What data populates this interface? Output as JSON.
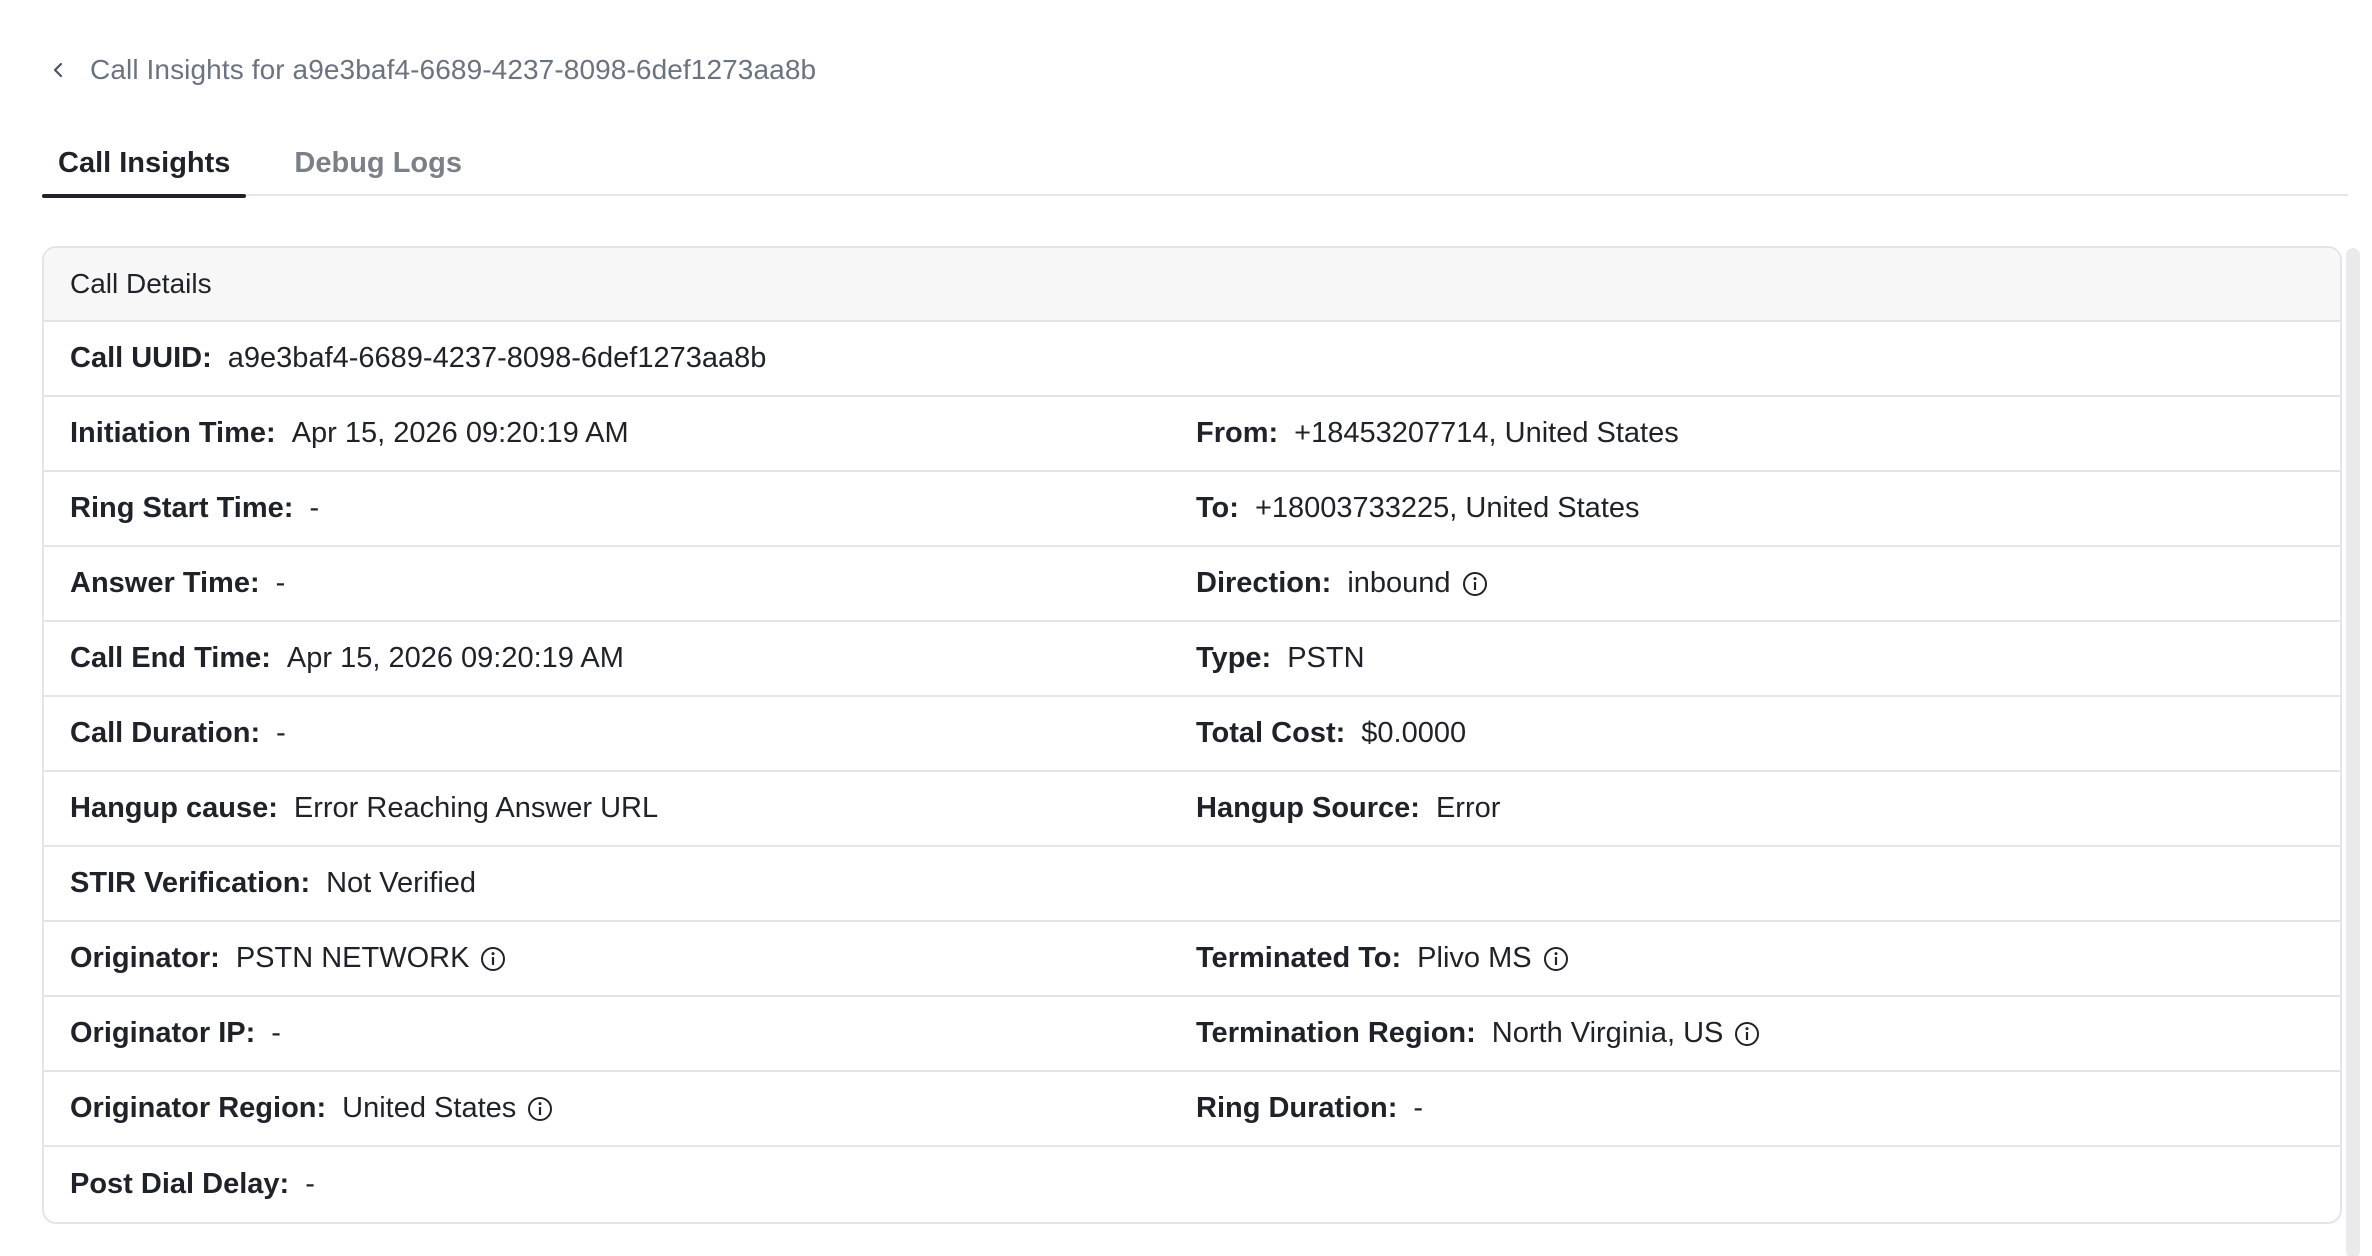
{
  "header": {
    "back_icon": "chevron-left-icon",
    "title": "Call Insights for a9e3baf4-6689-4237-8098-6def1273aa8b"
  },
  "tabs": [
    {
      "label": "Call Insights",
      "active": true
    },
    {
      "label": "Debug Logs",
      "active": false
    }
  ],
  "card": {
    "title": "Call Details",
    "call_uuid": {
      "label": "Call UUID:",
      "value": "a9e3baf4-6689-4237-8098-6def1273aa8b"
    },
    "initiation_time": {
      "label": "Initiation Time:",
      "value": "Apr 15, 2026 09:20:19 AM"
    },
    "from": {
      "label": "From:",
      "value": "+18453207714, United States"
    },
    "ring_start_time": {
      "label": "Ring Start Time:",
      "value": "-"
    },
    "to": {
      "label": "To:",
      "value": "+18003733225, United States"
    },
    "answer_time": {
      "label": "Answer Time:",
      "value": "-"
    },
    "direction": {
      "label": "Direction:",
      "value": "inbound"
    },
    "call_end_time": {
      "label": "Call End Time:",
      "value": "Apr 15, 2026 09:20:19 AM"
    },
    "type": {
      "label": "Type:",
      "value": "PSTN"
    },
    "call_duration": {
      "label": "Call Duration:",
      "value": "-"
    },
    "total_cost": {
      "label": "Total Cost:",
      "value": "$0.0000"
    },
    "hangup_cause": {
      "label": "Hangup cause:",
      "value": "Error Reaching Answer URL"
    },
    "hangup_source": {
      "label": "Hangup Source:",
      "value": "Error"
    },
    "stir_verification": {
      "label": "STIR Verification:",
      "value": "Not Verified"
    },
    "originator": {
      "label": "Originator:",
      "value": "PSTN NETWORK"
    },
    "terminated_to": {
      "label": "Terminated To:",
      "value": "Plivo MS"
    },
    "originator_ip": {
      "label": "Originator IP:",
      "value": "-"
    },
    "termination_region": {
      "label": "Termination Region:",
      "value": "North Virginia, US"
    },
    "originator_region": {
      "label": "Originator Region:",
      "value": "United States"
    },
    "ring_duration": {
      "label": "Ring Duration:",
      "value": "-"
    },
    "post_dial_delay": {
      "label": "Post Dial Delay:",
      "value": "-"
    }
  },
  "icons": {
    "info": "info-circle-icon"
  },
  "colors": {
    "text": "#1f2329",
    "muted": "#6b7280",
    "border": "#e3e5e8",
    "header_bg": "#f7f7f8"
  }
}
